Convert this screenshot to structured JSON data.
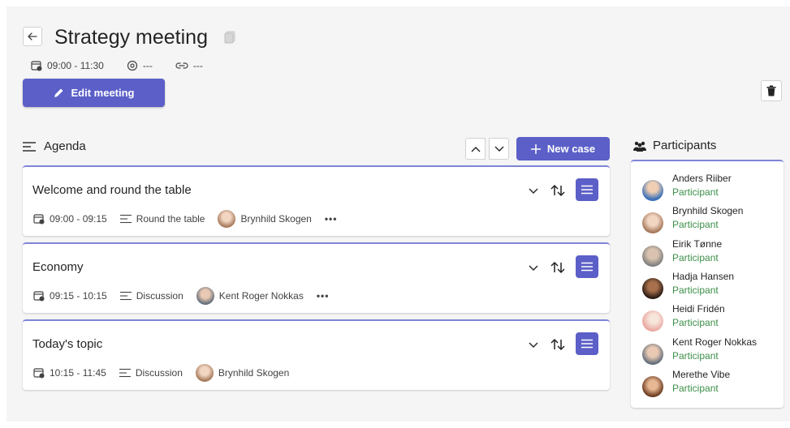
{
  "meeting": {
    "title": "Strategy meeting",
    "time": "09:00 - 11:30",
    "location": "---",
    "link": "---",
    "edit_label": "Edit meeting"
  },
  "agenda": {
    "heading": "Agenda",
    "new_case_label": "New case",
    "cases": [
      {
        "title": "Welcome and round the table",
        "time": "09:00 - 09:15",
        "type": "Round the table",
        "owner": "Brynhild Skogen",
        "more": "•••"
      },
      {
        "title": "Economy",
        "time": "09:15 - 10:15",
        "type": "Discussion",
        "owner": "Kent Roger Nokkas",
        "more": "•••"
      },
      {
        "title": "Today's topic",
        "time": "10:15 - 11:45",
        "type": "Discussion",
        "owner": "Brynhild Skogen"
      }
    ]
  },
  "participants": {
    "heading": "Participants",
    "items": [
      {
        "name": "Anders Riiber",
        "role": "Participant"
      },
      {
        "name": "Brynhild Skogen",
        "role": "Participant"
      },
      {
        "name": "Eirik Tønne",
        "role": "Participant"
      },
      {
        "name": "Hadja Hansen",
        "role": "Participant"
      },
      {
        "name": "Heidi Fridén",
        "role": "Participant"
      },
      {
        "name": "Kent Roger Nokkas",
        "role": "Participant"
      },
      {
        "name": "Merethe Vibe",
        "role": "Participant"
      }
    ]
  },
  "colors": {
    "accent": "#5b5fc7",
    "accent_border": "#7f85d8",
    "role_text": "#3c8f48",
    "panel_bg": "#f5f5f5"
  }
}
